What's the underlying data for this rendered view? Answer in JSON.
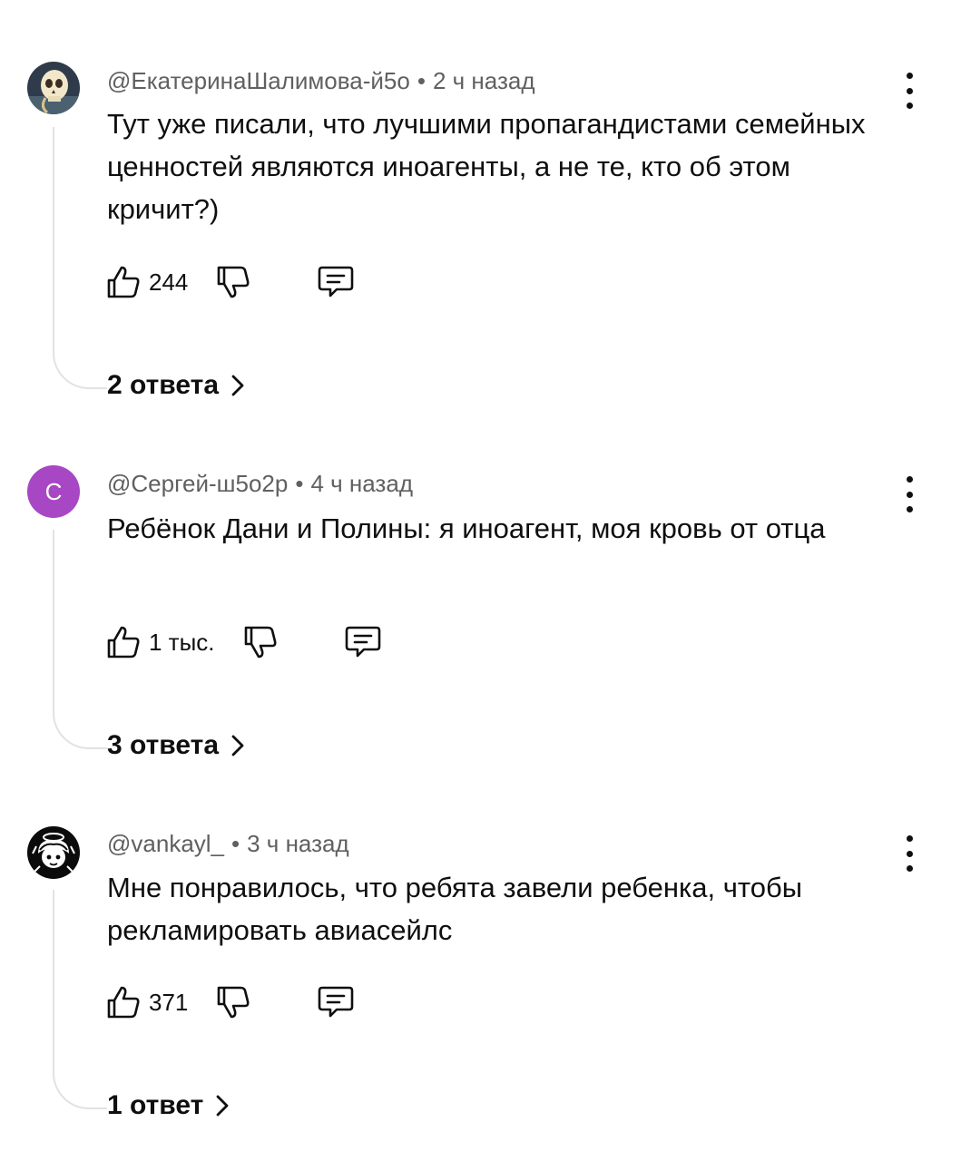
{
  "comments": [
    {
      "author": "@ЕкатеринаШалимова-й5о",
      "separator": "•",
      "time": "2 ч назад",
      "text": "Тут уже писали, что лучшими пропагандистами семейных ценностей являются иноагенты, а не те, кто об этом кричит?)",
      "likes": "244",
      "replies_label": "2 ответа",
      "avatar_icon": "skull-avatar-icon"
    },
    {
      "author": "@Сергей-ш5о2р",
      "separator": "•",
      "time": "4 ч назад",
      "text": "Ребёнок Дани и Полины: я иноагент, моя кровь от отца",
      "likes": "1 тыс.",
      "replies_label": "3 ответа",
      "avatar_letter": "С",
      "avatar_color": "#a847c4"
    },
    {
      "author": "@vankayl_",
      "separator": "•",
      "time": "3 ч назад",
      "text": "Мне понравилось, что ребята завели ребенка, чтобы рекламировать авиасейлс",
      "likes": "371",
      "replies_label": "1 ответ",
      "avatar_icon": "anime-drawing-avatar-icon"
    }
  ],
  "icons": {
    "like": "thumb-up-icon",
    "dislike": "thumb-down-icon",
    "reply": "comment-bubble-icon",
    "more": "more-vertical-icon",
    "chevron": "chevron-right-icon"
  }
}
